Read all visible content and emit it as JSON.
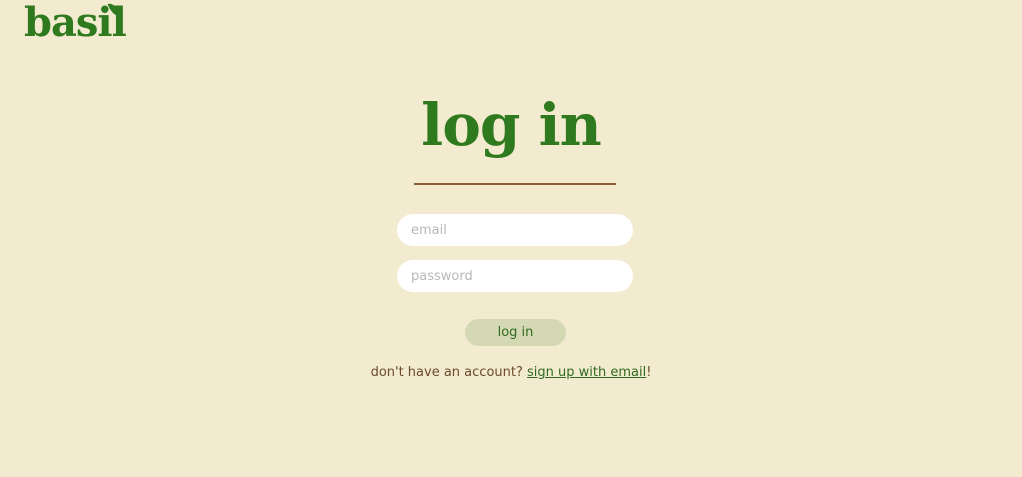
{
  "brand": {
    "logo_text": "basil"
  },
  "page": {
    "title": "log in"
  },
  "form": {
    "email_placeholder": "email",
    "email_value": "",
    "password_placeholder": "password",
    "password_value": "",
    "submit_label": "log in"
  },
  "signup": {
    "prompt": "don't have an account? ",
    "link_label": "sign up with email",
    "suffix": "!"
  },
  "colors": {
    "background": "#f3ebcf",
    "brand_green": "#2f7a1f",
    "divider_brown": "#8a6136",
    "button_bg": "#d4d9b4"
  }
}
